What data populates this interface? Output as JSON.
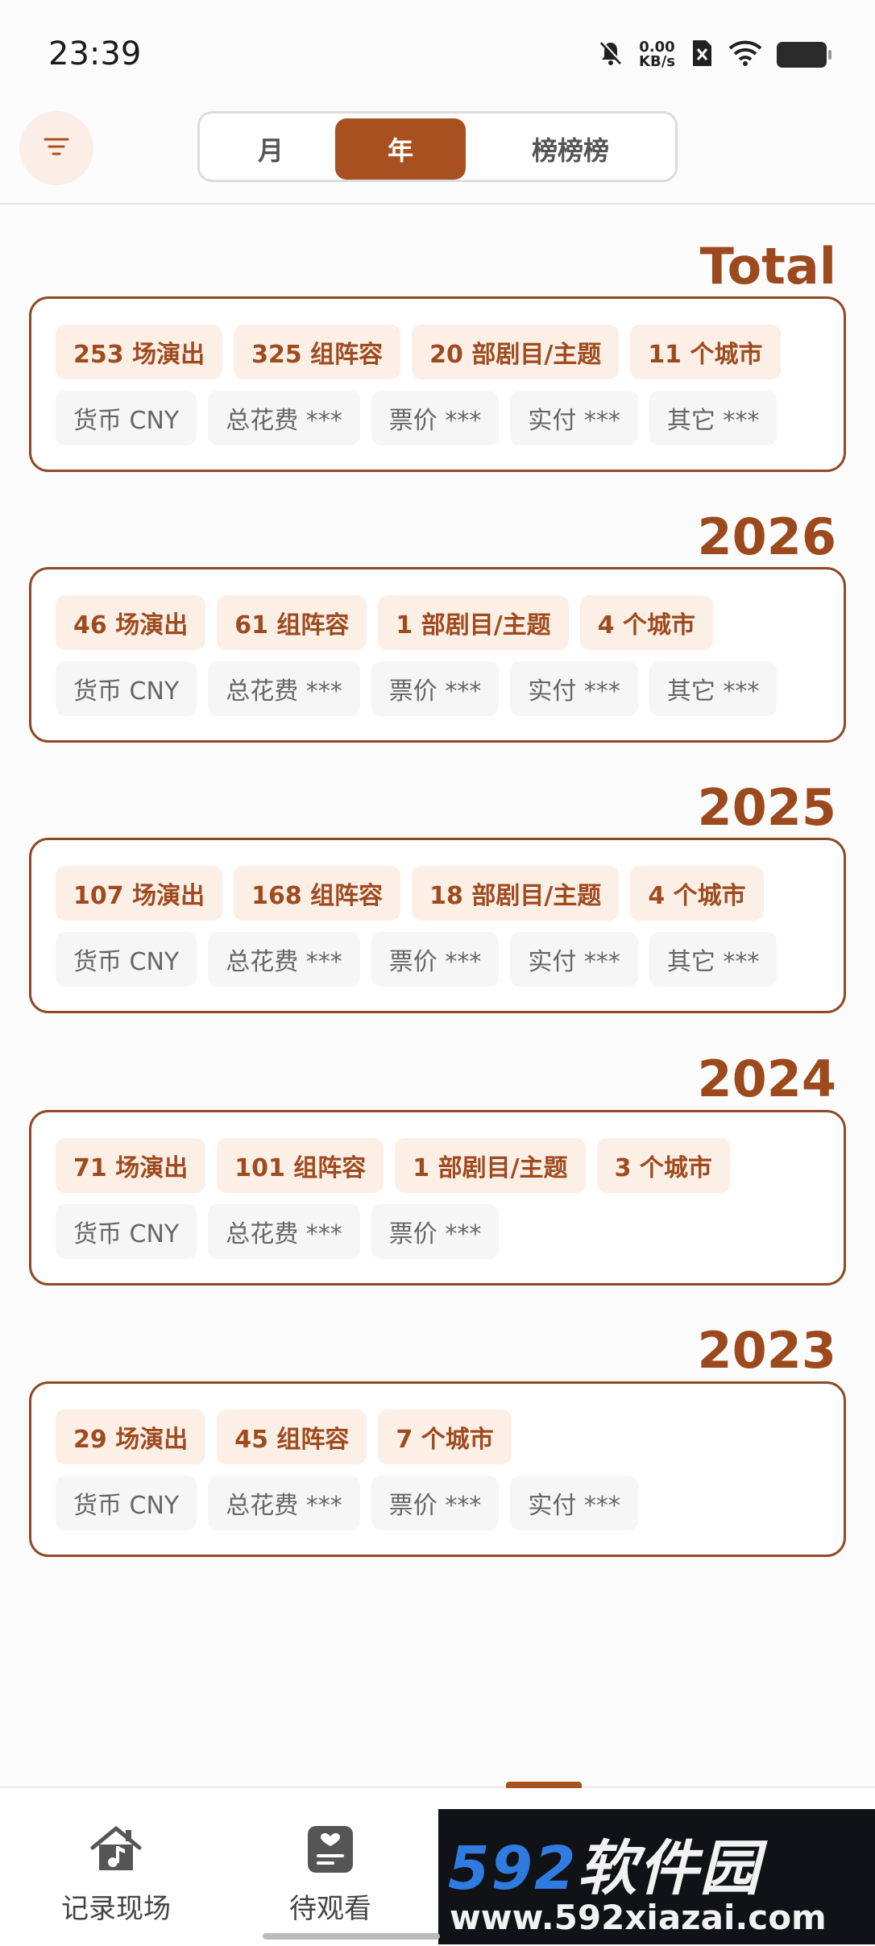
{
  "status": {
    "time": "23:39",
    "speed_value": "0.00",
    "speed_unit": "KB/s"
  },
  "header": {
    "tabs": [
      "月",
      "年",
      "榜榜榜"
    ],
    "active_tab": "年"
  },
  "sections": [
    {
      "year": "Total",
      "stats": [
        "253 场演出",
        "325 组阵容",
        "20 部剧目/主题",
        "11 个城市"
      ],
      "money": [
        "货币 CNY",
        "总花费 ***",
        "票价 ***",
        "实付 ***",
        "其它 ***"
      ]
    },
    {
      "year": "2026",
      "stats": [
        "46 场演出",
        "61 组阵容",
        "1 部剧目/主题",
        "4 个城市"
      ],
      "money": [
        "货币 CNY",
        "总花费 ***",
        "票价 ***",
        "实付 ***",
        "其它 ***"
      ]
    },
    {
      "year": "2025",
      "stats": [
        "107 场演出",
        "168 组阵容",
        "18 部剧目/主题",
        "4 个城市"
      ],
      "money": [
        "货币 CNY",
        "总花费 ***",
        "票价 ***",
        "实付 ***",
        "其它 ***"
      ]
    },
    {
      "year": "2024",
      "stats": [
        "71 场演出",
        "101 组阵容",
        "1 部剧目/主题",
        "3 个城市"
      ],
      "money": [
        "货币 CNY",
        "总花费 ***",
        "票价 ***"
      ]
    },
    {
      "year": "2023",
      "stats": [
        "29 场演出",
        "45 组阵容",
        "7 个城市"
      ],
      "money": [
        "货币 CNY",
        "总花费 ***",
        "票价 ***",
        "实付 ***"
      ]
    }
  ],
  "bottom_nav": {
    "record": "记录现场",
    "watch": "待观看"
  },
  "watermark": {
    "brand_number": "592",
    "brand_text": "软件园",
    "url": "www.592xiazai.com"
  },
  "colors": {
    "accent": "#a85120",
    "year_label": "#9c4a1d",
    "card_border": "#8e4a25",
    "stat_chip_bg": "#fcefe6",
    "money_chip_bg": "#f6f6f7"
  }
}
